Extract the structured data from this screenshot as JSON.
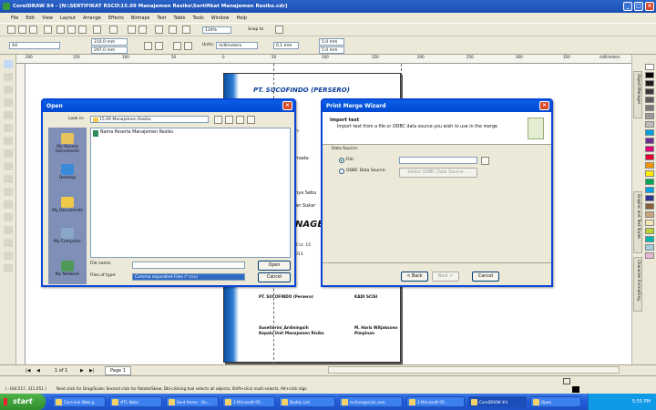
{
  "window": {
    "title": "CorelDRAW X4 - [N:\\SERTIFIKAT RSCO\\15.09 Manajemen Resiko\\Sertifikat Manajemen Resiko.cdr]"
  },
  "menu": [
    "File",
    "Edit",
    "View",
    "Layout",
    "Arrange",
    "Effects",
    "Bitmaps",
    "Text",
    "Table",
    "Tools",
    "Window",
    "Help"
  ],
  "toolbar": {
    "zoom": "119%",
    "snap_label": "Snap to",
    "paper": "A4",
    "width": "210.0 mm",
    "height": "297.0 mm",
    "units_label": "Units:",
    "units": "millimeters",
    "nudge": "0.1 mm",
    "dup_x": "5.0 mm",
    "dup_y": "5.0 mm"
  },
  "ruler": {
    "unit": "millimeters",
    "ticks": [
      "200",
      "150",
      "100",
      "50",
      "0",
      "50",
      "100",
      "150",
      "200",
      "250",
      "300",
      "350"
    ]
  },
  "document": {
    "heading": "PT. SUCOFINDO (PERSERO)",
    "text_fragments": [
      "n:",
      "mada:",
      "nya Sebu",
      "an Sukar",
      "NAGE",
      "2 Lt. 15",
      "013"
    ],
    "signer1_org": "PT. SUCOFINDO (Persero)",
    "signer2_org": "KADI SCISI",
    "signer1_name": "Susetiorini_Ardiningsih",
    "signer1_title": "Kepala Unit Manajemen Risiko",
    "signer2_name": "M. Haris Witjaksono",
    "signer2_title": "Pimpinan"
  },
  "open_dialog": {
    "title": "Open",
    "look_in_label": "Look in:",
    "look_in": "15.09 Manajemen Resiko",
    "places": [
      "My Recent Documents",
      "Desktop",
      "My Documents",
      "My Computer",
      "My Network"
    ],
    "files": [
      "Nama Peserta Manajemen Resiko"
    ],
    "file_name_label": "File name:",
    "file_name": "",
    "file_type_label": "Files of type:",
    "file_type": "Comma separated Files (*.csv)",
    "open_btn": "Open",
    "cancel_btn": "Cancel"
  },
  "merge_dialog": {
    "title": "Print Merge Wizard",
    "header_title": "Import text",
    "header_desc": "Import text from a file or ODBC data source you wish to use in the merge",
    "source_label": "Data Source:",
    "file_option": "File:",
    "odbc_option": "ODBC Data Source:",
    "odbc_btn": "Select ODBC Data Source ...",
    "back_btn": "< Back",
    "next_btn": "Next >",
    "cancel_btn": "Cancel"
  },
  "pagebar": {
    "counter": "1 of 1",
    "tab": "Page 1"
  },
  "status": {
    "coords": "( -164.517, 311.051 )",
    "hint": "Next click for Drag/Scale; Second click for Rotate/Skew; Dbl-clicking tool selects all objects; Shift+click multi-selects; Alt+click digs"
  },
  "dockers": [
    "Object Manager",
    "Graphic and Text Styles",
    "Character Formatting"
  ],
  "palette": [
    "#ffffff",
    "#000000",
    "#1b1b1b",
    "#3a3a3a",
    "#5a5a5a",
    "#7a7a7a",
    "#9a9a9a",
    "#bdbdbd",
    "#00a0e0",
    "#6a2c91",
    "#e0007a",
    "#e4002b",
    "#f39200",
    "#ffed00",
    "#00a651",
    "#009fe3",
    "#2e3192",
    "#8b5e3c",
    "#c8a27a",
    "#f5e6b4",
    "#b7d433",
    "#00b5ad",
    "#a4cde0",
    "#e6b8d2"
  ],
  "taskbar": {
    "start": "start",
    "tasks": [
      "Cara link Web g...",
      "#TL Note",
      "Sent Items - Ou...",
      "3 Microsoft Of...",
      "Buddy List",
      "m.tiara@scisi.com",
      "3 Microsoft Of...",
      "CorelDRAW #4",
      "Open"
    ],
    "clock": "5:55 PM"
  }
}
